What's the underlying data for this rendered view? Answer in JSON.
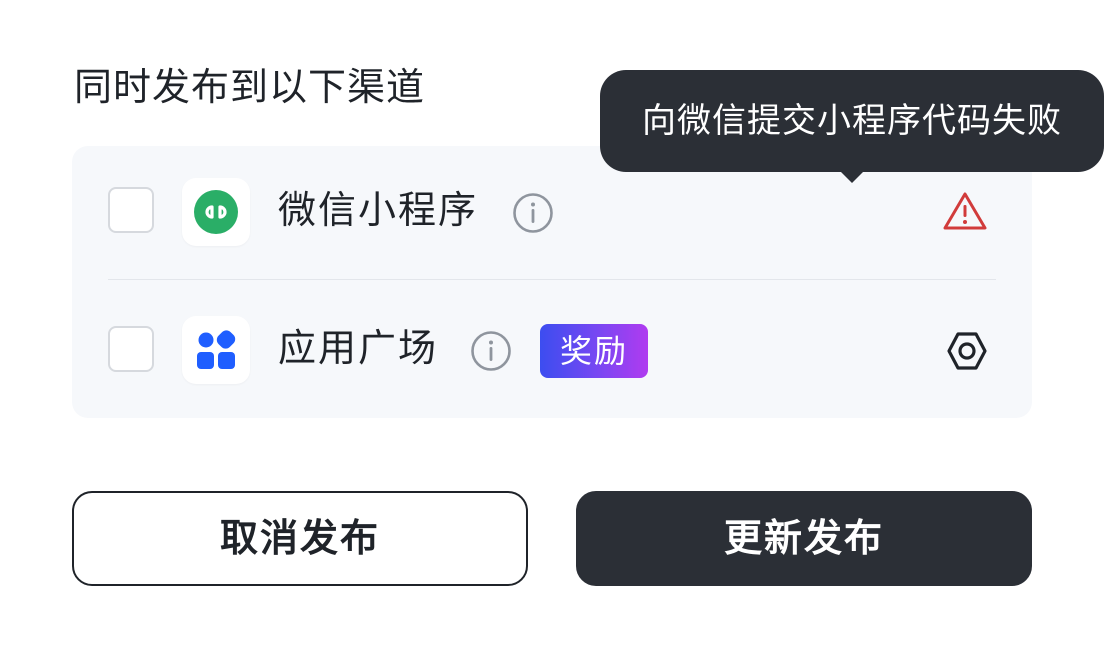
{
  "section": {
    "title": "同时发布到以下渠道"
  },
  "channels": [
    {
      "name": "微信小程序",
      "icon": "wechat-miniprogram-icon",
      "icon_color": "#2aae67",
      "status_icon": "warning-icon",
      "status_color": "#d13b3b",
      "checked": false
    },
    {
      "name": "应用广场",
      "icon": "app-square-icon",
      "icon_color": "#1f5eff",
      "badge": "奖励",
      "status_icon": "settings-icon",
      "checked": false
    }
  ],
  "tooltip": {
    "text": "向微信提交小程序代码失败"
  },
  "actions": {
    "cancel_label": "取消发布",
    "publish_label": "更新发布"
  },
  "colors": {
    "dark": "#2b2f36",
    "card_bg": "#f6f8fb",
    "badge_gradient_start": "#3c4df0",
    "badge_gradient_end": "#b03bf0"
  }
}
